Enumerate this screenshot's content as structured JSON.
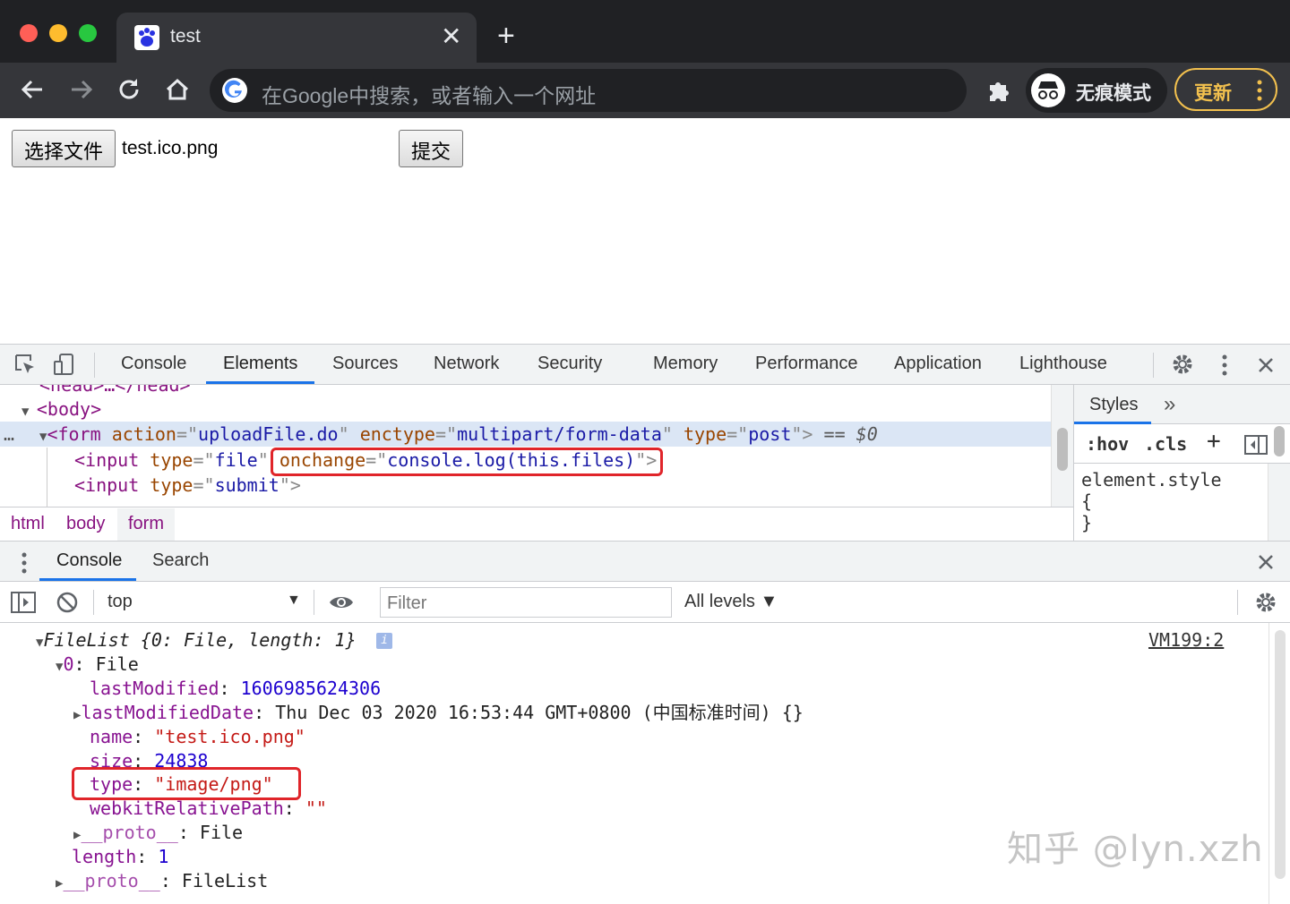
{
  "browser": {
    "tab_title": "test",
    "new_tab_symbol": "+",
    "close_symbol": "✕",
    "omnibox_placeholder": "在Google中搜索，或者输入一个网址",
    "incognito_label": "无痕模式",
    "update_label": "更新"
  },
  "page": {
    "choose_file_label": "选择文件",
    "file_name": "test.ico.png",
    "submit_label": "提交"
  },
  "devtools": {
    "tabs": [
      "Console",
      "Elements",
      "Sources",
      "Network",
      "Security",
      "Memory",
      "Performance",
      "Application",
      "Lighthouse"
    ],
    "elements": {
      "line_head": "<head>…</head>",
      "body_tag": "<body>",
      "form_open": "<form",
      "form_action_attr": "action",
      "form_action_val": "uploadFile.do",
      "form_enctype_attr": "enctype",
      "form_enctype_val": "multipart/form-data",
      "form_type_attr": "type",
      "form_type_val": "post",
      "selected_marker": "== $0",
      "input1_open": "<input",
      "input1_type_attr": "type",
      "input1_type_val": "file",
      "input1_onchange_attr": "onchange",
      "input1_onchange_val": "console.log(this.files)",
      "input2_open": "<input",
      "input2_type_attr": "type",
      "input2_type_val": "submit"
    },
    "breadcrumb": [
      "html",
      "body",
      "form"
    ],
    "styles": {
      "tab_label": "Styles",
      "more_symbol": "»",
      "hov": ":hov",
      "cls": ".cls",
      "element_style": "element.style",
      "brace_open": "{",
      "brace_close": "}"
    },
    "drawer": {
      "tabs": [
        "Console",
        "Search"
      ],
      "context": "top",
      "filter_placeholder": "Filter",
      "levels": "All levels ▼"
    },
    "console": {
      "source_link": "VM199:2",
      "filelist_summary": "FileList {0: File, length: 1}",
      "item0_key": "0",
      "item0_type": "File",
      "lastModified_key": "lastModified",
      "lastModified_val": "1606985624306",
      "lastModifiedDate_key": "lastModifiedDate",
      "lastModifiedDate_val": "Thu Dec 03 2020 16:53:44 GMT+0800 (中国标准时间) {}",
      "name_key": "name",
      "name_val": "\"test.ico.png\"",
      "size_key": "size",
      "size_val": "24838",
      "type_key": "type",
      "type_val": "\"image/png\"",
      "webkitRelativePath_key": "webkitRelativePath",
      "webkitRelativePath_val": "\"\"",
      "proto_key": "__proto__",
      "proto_val": "File",
      "length_key": "length",
      "length_val": "1",
      "proto2_key": "__proto__",
      "proto2_val": "FileList"
    }
  },
  "watermark": "知乎 @lyn.xzh",
  "colors": {
    "chrome_dark": "#202124",
    "chrome_toolbar": "#35363a",
    "devtools_accent": "#1a73e8",
    "highlight_red": "#e0252a",
    "update_yellow": "#f2c04e"
  }
}
